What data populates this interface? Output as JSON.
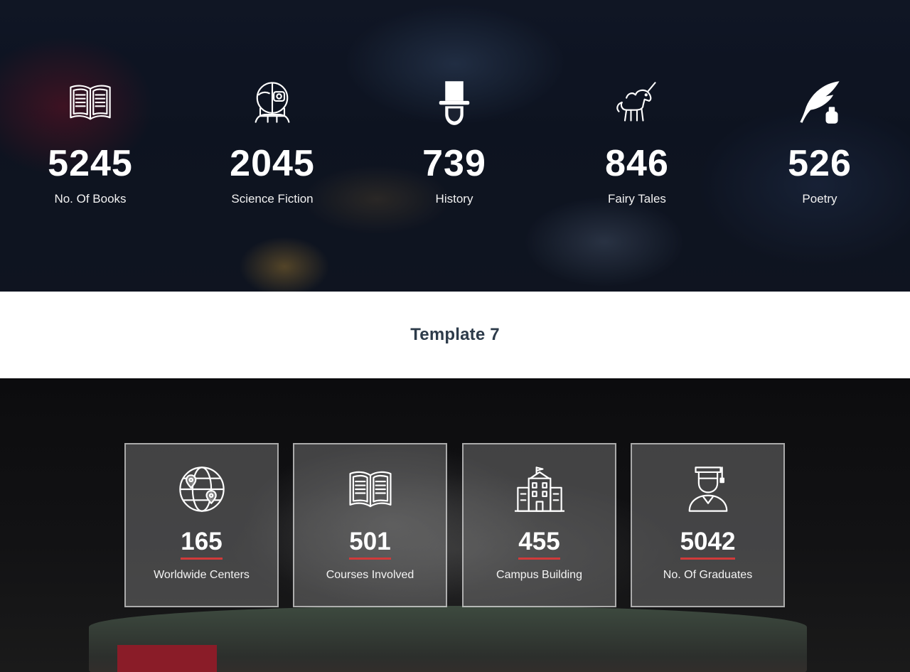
{
  "top_stats": [
    {
      "icon": "open-book-icon",
      "value": "5245",
      "label": "No. Of Books"
    },
    {
      "icon": "robot-head-icon",
      "value": "2045",
      "label": "Science Fiction"
    },
    {
      "icon": "top-hat-icon",
      "value": "739",
      "label": "History"
    },
    {
      "icon": "unicorn-icon",
      "value": "846",
      "label": "Fairy Tales"
    },
    {
      "icon": "quill-ink-icon",
      "value": "526",
      "label": "Poetry"
    }
  ],
  "section_title": "Template 7",
  "bottom_stats": [
    {
      "icon": "globe-pins-icon",
      "value": "165",
      "label": "Worldwide Centers"
    },
    {
      "icon": "open-book-icon",
      "value": "501",
      "label": "Courses Involved"
    },
    {
      "icon": "campus-building-icon",
      "value": "455",
      "label": "Campus Building"
    },
    {
      "icon": "graduate-icon",
      "value": "5042",
      "label": "No. Of Graduates"
    }
  ],
  "colors": {
    "title_text": "#2d3b4a",
    "number_underline": "#d13a3a",
    "card_border": "#ffffff"
  }
}
